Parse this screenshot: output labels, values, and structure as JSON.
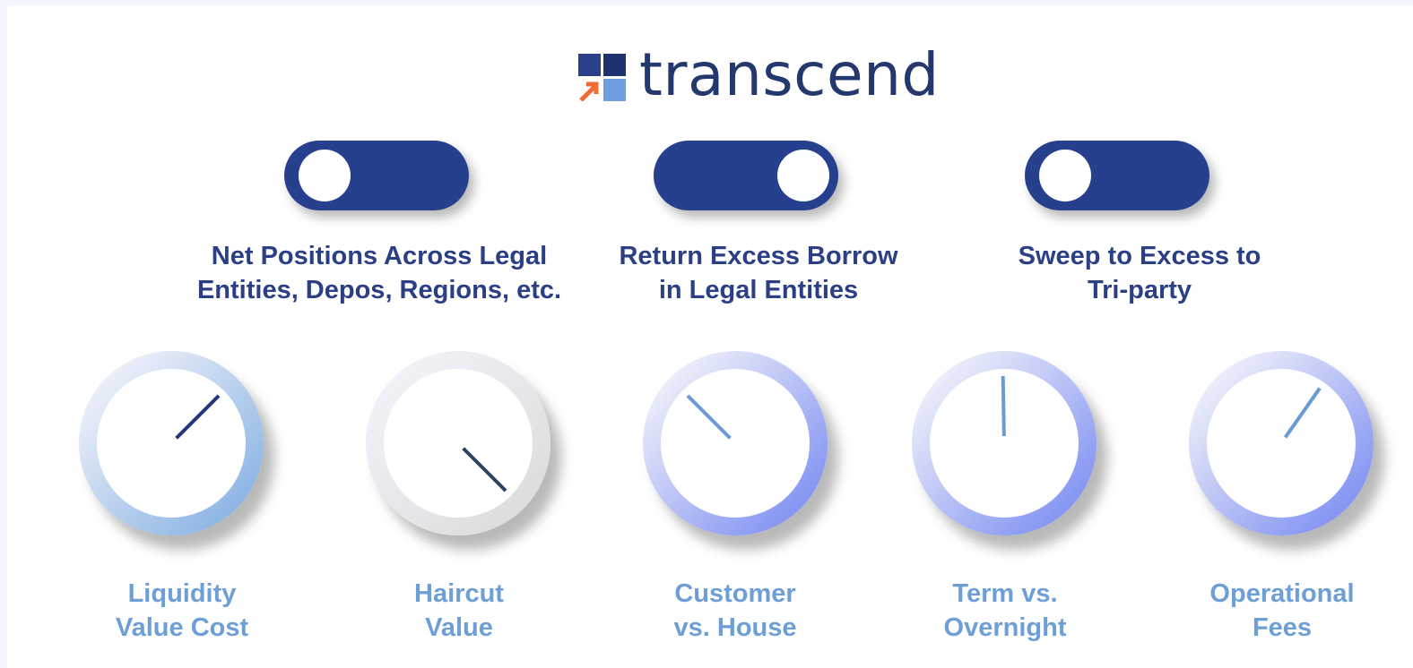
{
  "logo": {
    "text": "transcend",
    "colors": {
      "dark_blue": "#2b3f8c",
      "light_blue": "#6f9fe0",
      "orange": "#ee6c36",
      "text": "#24386e"
    }
  },
  "colors": {
    "toggle_track": "#27408e",
    "toggle_label": "#2b3f84",
    "dial_label": "#6d9fd6"
  },
  "toggles": [
    {
      "label_line1": "Net Positions Across Legal",
      "label_line2": "Entities, Depos, Regions, etc.",
      "state": "off"
    },
    {
      "label_line1": "Return Excess Borrow",
      "label_line2": "in Legal Entities",
      "state": "on"
    },
    {
      "label_line1": "Sweep to Excess to",
      "label_line2": "Tri-party",
      "state": "off"
    }
  ],
  "dials": [
    {
      "label_line1": "Liquidity",
      "label_line2": "Value Cost",
      "needle_angle_deg": 45,
      "ring_color": "#87b2e3",
      "needle_color": "#26387d"
    },
    {
      "label_line1": "Haircut",
      "label_line2": "Value",
      "needle_angle_deg": 135,
      "ring_color": "#dcdcdc",
      "needle_color": "#2c4666"
    },
    {
      "label_line1": "Customer",
      "label_line2": "vs. House",
      "needle_angle_deg": -45,
      "ring_color": "#7e8ff2",
      "needle_color": "#6a9bd5"
    },
    {
      "label_line1": "Term vs.",
      "label_line2": "Overnight",
      "needle_angle_deg": -1,
      "ring_color": "#7e8ff2",
      "needle_color": "#6a9bd5"
    },
    {
      "label_line1": "Operational",
      "label_line2": "Fees",
      "needle_angle_deg": 35,
      "ring_color": "#7e8ff2",
      "needle_color": "#6a9bd5"
    }
  ]
}
